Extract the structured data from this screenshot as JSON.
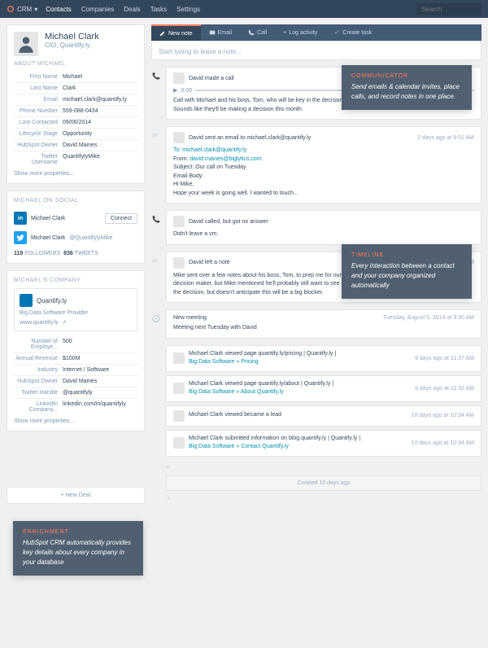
{
  "topnav": {
    "brand": "CRM",
    "items": [
      "Contacts",
      "Companies",
      "Deals",
      "Tasks",
      "Settings"
    ],
    "search_placeholder": "Search"
  },
  "contact": {
    "name": "Michael Clark",
    "title": "CIO, Quantify.ly",
    "about_label": "ABOUT MICHAEL",
    "props": [
      {
        "label": "First Name",
        "value": "Michael"
      },
      {
        "label": "Last Name",
        "value": "Clark"
      },
      {
        "label": "Email",
        "value": "michael.clark@quantify.ly"
      },
      {
        "label": "Phone Number",
        "value": "559-088-0434"
      },
      {
        "label": "Last Contacted",
        "value": "09/06/2014"
      },
      {
        "label": "Lifecycle Stage",
        "value": "Opportunity"
      },
      {
        "label": "HubSpot Owner",
        "value": "David Maines"
      },
      {
        "label": "Twitter Username",
        "value": "QuantifylyMike"
      }
    ],
    "show_more": "Show more properties..."
  },
  "social": {
    "label": "MICHAEL ON SOCIAL",
    "linkedin_name": "Michael Clark",
    "twitter_name": "Michael Clark",
    "twitter_handle": "@QuantifylyMike",
    "connect": "Connect",
    "followers": "119",
    "followers_label": "FOLLOWERS",
    "tweets": "836",
    "tweets_label": "TWEETS"
  },
  "company": {
    "label": "MICHAEL'S COMPANY",
    "name": "Quantify.ly",
    "sub": "Big Data Software Provider",
    "url": "www.quantify.ly",
    "props": [
      {
        "label": "Number of Employe...",
        "value": "500"
      },
      {
        "label": "Annual Revenue",
        "value": "$100M"
      },
      {
        "label": "Industry",
        "value": "Internet / Software"
      },
      {
        "label": "HubSpot Owner",
        "value": "David Maines"
      },
      {
        "label": "Twitter Handle",
        "value": "@quantifyly"
      },
      {
        "label": "LinkedIn Company...",
        "value": "linkedin.com/in/quantifyly"
      }
    ],
    "show_more": "Show more properties...",
    "new_deal": "+  New Deal"
  },
  "tabs": {
    "new_note": "New note",
    "email": "Email",
    "call": "Call",
    "log": "Log activity",
    "task": "Create task"
  },
  "note_placeholder": "Start typing to leave a note...",
  "timeline": [
    {
      "type": "call",
      "author": "David made a call",
      "time": "",
      "body": "Call with Michael and his boss, Tom, who will be key in the decision making process. We talked about their timeline. Sounds like they'll be making a decision this month.",
      "audio": "0:00"
    },
    {
      "type": "email",
      "author": "David sent an email to michael.clark@quantify.ly",
      "time": "2 days ago at 9:51 AM",
      "to": "To: michael.clark@quantify.ly",
      "from": "From: david.maines@biglytics.com",
      "subject": "Subject: Our call on Tuesday",
      "body_label": "Email Body:",
      "body": "Hi Mike,\nHope your week is going well. I wanted to touch..."
    },
    {
      "type": "call2",
      "author": "David called, but got no answer",
      "time": "",
      "body": "Didn't leave a vm."
    },
    {
      "type": "note",
      "author": "David left a note",
      "time": "9 days ago at 10:54 AM",
      "body": "Mike sent over a few notes about his boss, Tom, to prep me for our call next week. Tom is the VP and the ultimate decision maker, but Mike mentioned he'll probably still want to see a full demo. Tom may involve the IT department in the decision, but doesn't anticipate this will be a big blocker."
    },
    {
      "type": "meeting",
      "title": "New meeting",
      "time": "Tuesday, August 5, 2014 at 9:30 AM",
      "body": "Meeting next Tuesday with David"
    }
  ],
  "views": [
    {
      "text": "Michael Clark viewed page quantify.ly/pricing | Quantify.ly |",
      "link": "Big Data Software » Pricing",
      "time": "9 days ago at 11:37 AM"
    },
    {
      "text": "Michael Clark viewed page quantify.ly/about | Quantify.ly |",
      "link": "Big Data Software » About Quantify.ly",
      "time": "9 days ago at 11:32 AM"
    },
    {
      "text": "Michael Clark viewed became a lead",
      "link": "",
      "time": "10 days ago at 10:34 AM"
    },
    {
      "text": "Michael Clark submitted information on blog.quantify.ly | Quantify.ly |",
      "link": "Big Data Software » Contact Quantify.ly",
      "time": "10 days ago at 10:34 AM"
    }
  ],
  "created": "Created 10 days ago",
  "callouts": {
    "communicator": {
      "title": "COMMUNICATOR",
      "text": "Send emails & calendar invites, place calls, and record notes in one place."
    },
    "timeline": {
      "title": "TIMELINE",
      "text": "Every interaction between a contact and your company organized automatically"
    },
    "enrichment": {
      "title": "ENRICHMENT",
      "text": "HubSpot CRM automatically provides key details about every company in your database"
    }
  }
}
